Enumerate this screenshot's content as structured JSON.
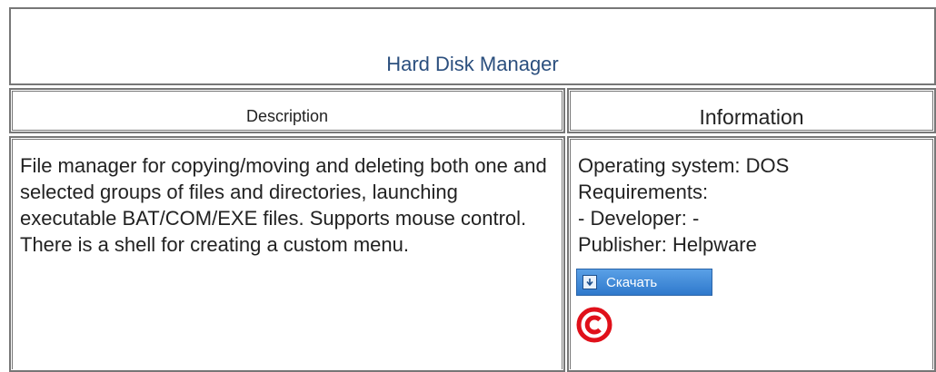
{
  "title": "Hard Disk Manager",
  "headers": {
    "description": "Description",
    "information": "Information"
  },
  "description": "File manager for copying/moving and deleting both one and selected groups of files and directories, launching executable BAT/COM/EXE files. Supports mouse control. There is a shell for creating a custom menu.",
  "info": {
    "os": "Operating system: DOS",
    "requirements": "Requirements:",
    "developer": "- Developer: -",
    "publisher": "Publisher: Helpware"
  },
  "download_button": {
    "label": "Скачать",
    "icon": "download-arrow-icon"
  },
  "copyright_icon": "copyright-icon",
  "colors": {
    "title": "#2b4f7e",
    "border": "#777777",
    "button": "#3a86d8",
    "copyright": "#e0101a"
  }
}
